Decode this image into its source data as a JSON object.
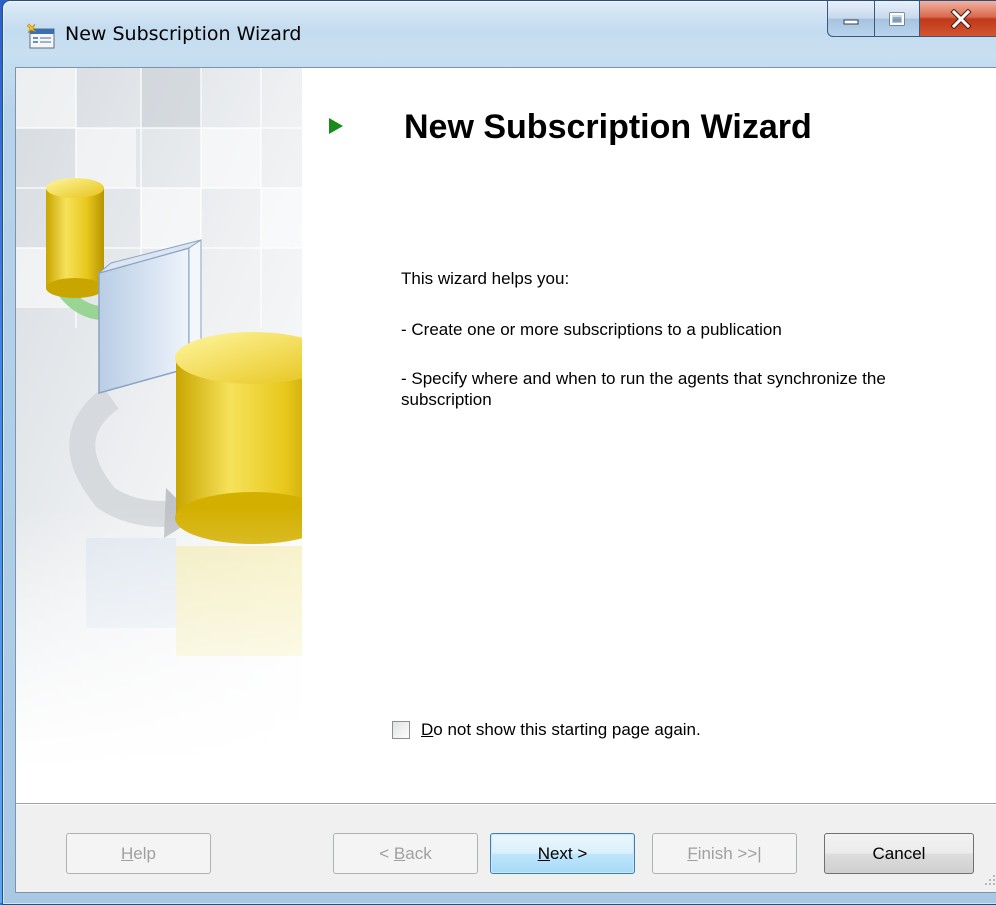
{
  "window": {
    "title": "New Subscription Wizard"
  },
  "header": {
    "title": "New Subscription Wizard"
  },
  "body": {
    "intro": "This wizard helps you:",
    "point1": "- Create one or more subscriptions to a publication",
    "point2": "- Specify where and when to run the agents that synchronize the subscription"
  },
  "checkbox": {
    "label_first": "D",
    "label_rest": "o not show this starting page again.",
    "checked": false
  },
  "buttons": {
    "help_first": "H",
    "help_rest": "elp",
    "back_prefix": "< ",
    "back_first": "B",
    "back_rest": "ack",
    "next_first": "N",
    "next_rest": "ext >",
    "finish_first": "F",
    "finish_rest": "inish >>|",
    "cancel": "Cancel"
  },
  "icons": [
    "app-icon",
    "minimize-icon",
    "maximize-icon",
    "close-icon",
    "header-arrow-icon",
    "database-icon",
    "book-icon"
  ]
}
